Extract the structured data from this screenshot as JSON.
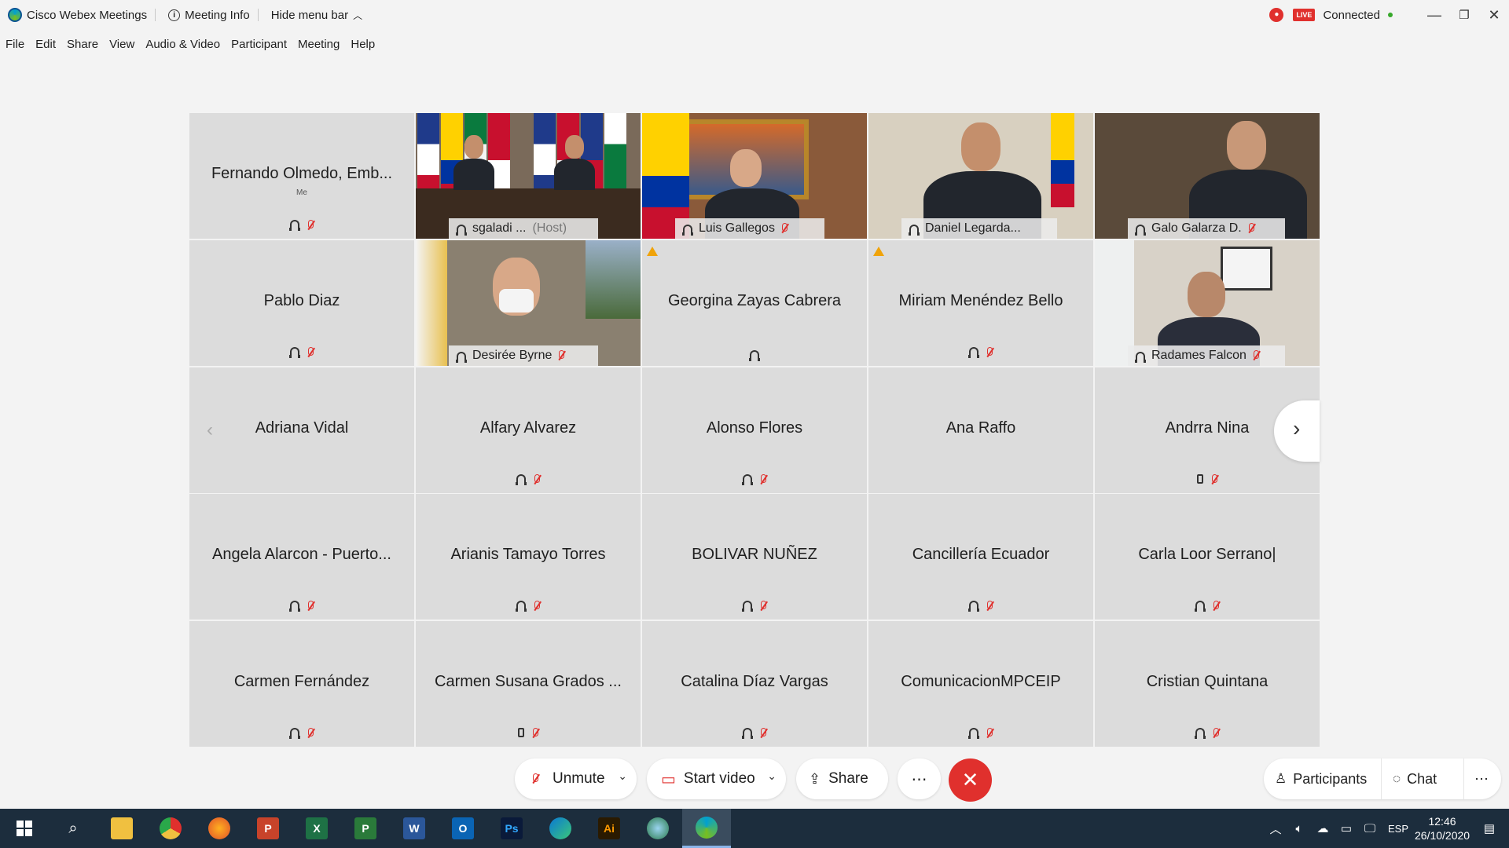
{
  "titlebar": {
    "app_name": "Cisco Webex Meetings",
    "meeting_info": "Meeting Info",
    "hide_menu": "Hide menu bar",
    "live_label": "LIVE",
    "status": "Connected"
  },
  "menu": [
    "File",
    "Edit",
    "Share",
    "View",
    "Audio & Video",
    "Participant",
    "Meeting",
    "Help"
  ],
  "me_label": "Me",
  "participants_row1": {
    "fernando": "Fernando Olmedo, Emb...",
    "sgaladi": "sgaladi ...",
    "host_tag": "(Host)",
    "luis": "Luis Gallegos",
    "daniel": "Daniel Legarda...",
    "galo": "Galo Galarza D."
  },
  "participants_row2": {
    "pablo": "Pablo Diaz",
    "desiree": "Desirée Byrne",
    "georgina": "Georgina Zayas Cabrera",
    "miriam": "Miriam Menéndez Bello",
    "radames": "Radames Falcon"
  },
  "participants_row3": [
    "Adriana Vidal",
    "Alfary Alvarez",
    "Alonso Flores",
    "Ana Raffo",
    "Andrra Nina"
  ],
  "participants_row4": [
    "Angela Alarcon - Puerto...",
    "Arianis Tamayo Torres",
    "BOLIVAR NUÑEZ",
    "Cancillería Ecuador",
    "Carla Loor Serrano|"
  ],
  "participants_row5": [
    "Carmen Fernández",
    "Carmen Susana Grados ...",
    "Catalina Díaz Vargas",
    "ComunicacionMPCEIP",
    "Cristian Quintana"
  ],
  "controls": {
    "unmute": "Unmute",
    "start_video": "Start video",
    "share": "Share",
    "participants": "Participants",
    "chat": "Chat"
  },
  "taskbar": {
    "language": "ESP",
    "time": "12:46",
    "date": "26/10/2020"
  },
  "colors": {
    "accent_red": "#e0302d",
    "tile_bg": "#dcdcdc",
    "taskbar": "#1c2d3d"
  }
}
